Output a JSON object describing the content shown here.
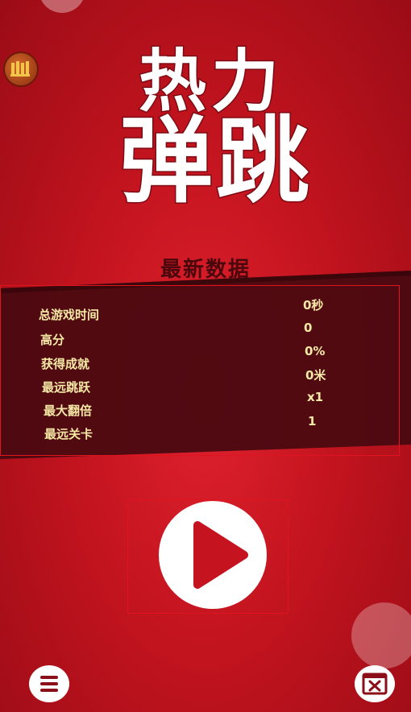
{
  "game": {
    "title_line1": "热力",
    "title_line2": "弹跳"
  },
  "stats": {
    "heading": "最新数据",
    "rows": [
      {
        "label": "总游戏时间",
        "value": "0秒"
      },
      {
        "label": "高分",
        "value": "0"
      },
      {
        "label": "获得成就",
        "value": "0%"
      },
      {
        "label": "最远跳跃",
        "value": "0米"
      },
      {
        "label": "最大翻倍",
        "value": "x1"
      },
      {
        "label": "最远关卡",
        "value": "1"
      }
    ]
  },
  "icons": {
    "badge": "trophy-badge-icon",
    "play": "play-icon",
    "menu": "menu-icon",
    "video": "video-icon"
  },
  "colors": {
    "background": "#c3141f",
    "stat_text": "#f6e9a6",
    "panel": "#4a0a10",
    "highlight_frame": "#e0141f"
  }
}
